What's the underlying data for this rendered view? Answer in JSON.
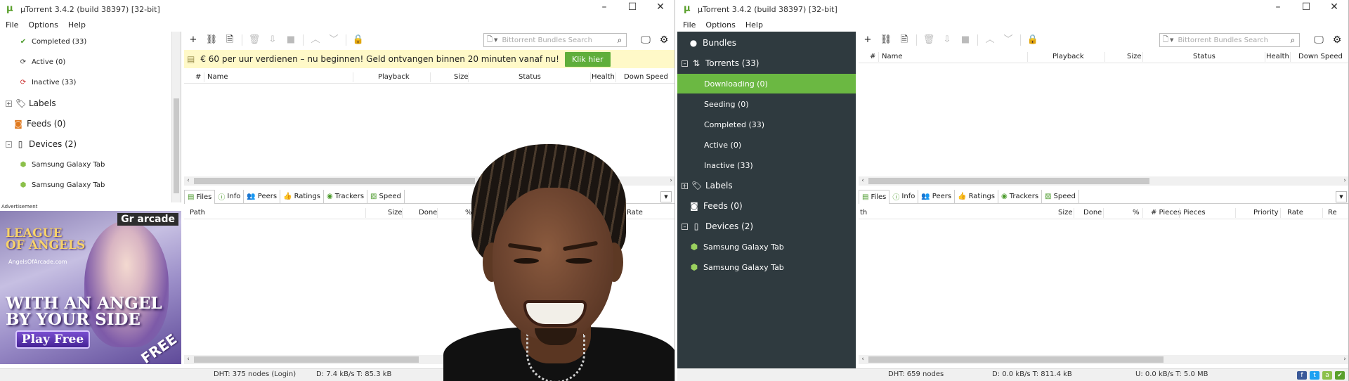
{
  "left_window": {
    "title": "µTorrent 3.4.2  (build 38397) [32-bit]",
    "menu": [
      "File",
      "Options",
      "Help"
    ],
    "sidebar": {
      "items": [
        {
          "label": "Completed (33)",
          "icon": "check-icon"
        },
        {
          "label": "Active (0)",
          "icon": "refresh-icon"
        },
        {
          "label": "Inactive (33)",
          "icon": "inactive-icon"
        },
        {
          "label": "Labels",
          "icon": "tag-icon"
        },
        {
          "label": "Feeds (0)",
          "icon": "rss-icon"
        },
        {
          "label": "Devices (2)",
          "icon": "phone-icon"
        },
        {
          "label": "Samsung Galaxy Tab",
          "icon": "android-icon"
        },
        {
          "label": "Samsung Galaxy Tab",
          "icon": "android-icon"
        }
      ]
    },
    "ad": {
      "label": "Advertisement",
      "brand": "Gr arcade",
      "logo_line1": "LEAGUE",
      "logo_line2": "OF ANGELS",
      "url": "AngelsOfArcade.com",
      "headline_1": "WITH AN ANGEL",
      "headline_2": "BY YOUR SIDE",
      "cta": "Play Free",
      "corner": "FREE"
    },
    "search": {
      "placeholder": "Bittorrent Bundles Search"
    },
    "promo": {
      "text": "€ 60 per uur verdienen – nu beginnen! Geld ontvangen binnen 20 minuten vanaf nu!",
      "button": "Klik hier"
    },
    "columns": [
      "#",
      "Name",
      "Playback",
      "Size",
      "Status",
      "Health",
      "Down Speed"
    ],
    "tabs": [
      "Files",
      "Info",
      "Peers",
      "Ratings",
      "Trackers",
      "Speed"
    ],
    "file_columns": [
      "Path",
      "Size",
      "Done",
      "%",
      "Rate"
    ],
    "status": {
      "dht": "DHT: 375 nodes (Login)",
      "transfer": "D: 7.4 kB/s T: 85.3 kB"
    }
  },
  "right_window": {
    "title": "µTorrent 3.4.2  (build 38397) [32-bit]",
    "menu": [
      "File",
      "Options",
      "Help"
    ],
    "sidebar": {
      "bundles": "Bundles",
      "torrents": "Torrents (33)",
      "downloading": "Downloading (0)",
      "seeding": "Seeding (0)",
      "completed": "Completed (33)",
      "active": "Active (0)",
      "inactive": "Inactive (33)",
      "labels": "Labels",
      "feeds": "Feeds (0)",
      "devices": "Devices (2)",
      "device_1": "Samsung Galaxy Tab",
      "device_2": "Samsung Galaxy Tab"
    },
    "search": {
      "placeholder": "Bittorrent Bundles Search"
    },
    "columns": [
      "#",
      "Name",
      "Playback",
      "Size",
      "Status",
      "Health",
      "Down Speed"
    ],
    "tabs": [
      "Files",
      "Info",
      "Peers",
      "Ratings",
      "Trackers",
      "Speed"
    ],
    "file_columns": [
      "th",
      "Size",
      "Done",
      "%",
      "# Pieces",
      "Pieces",
      "Priority",
      "Rate",
      "Re"
    ],
    "status": {
      "dht": "DHT: 659 nodes",
      "download": "D: 0.0 kB/s T: 811.4 kB",
      "upload": "U: 0.0 kB/s T: 5.0 MB"
    }
  },
  "colors": {
    "accent_green": "#6bb842",
    "sidebar_dark": "#2f3a3f",
    "promo_bg": "#fff9c8"
  }
}
